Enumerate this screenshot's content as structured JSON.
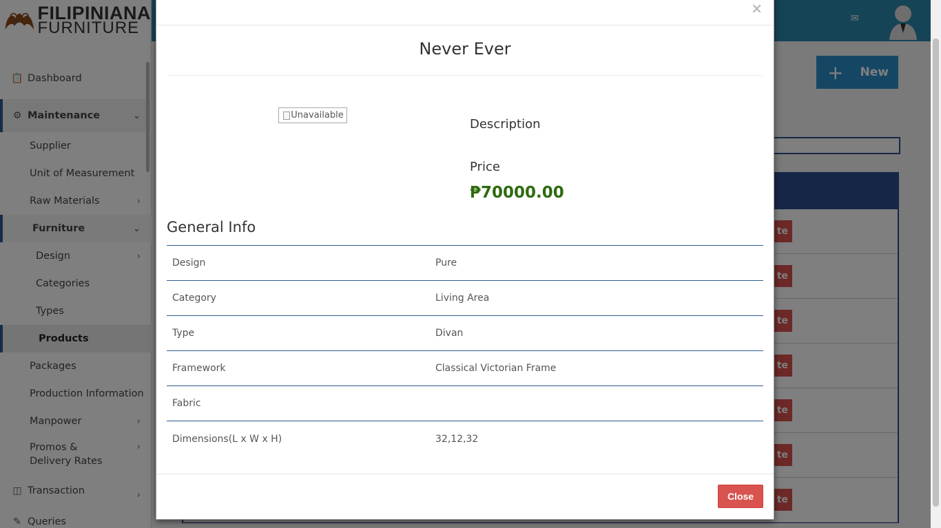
{
  "brand": {
    "line1": "FILIPINIANA",
    "line2": "FURNITURE"
  },
  "sidebar": {
    "items": [
      {
        "label": "Dashboard",
        "icon": "clipboard-icon"
      },
      {
        "label": "Maintenance",
        "icon": "gear-icon"
      },
      {
        "label": "Supplier"
      },
      {
        "label": "Unit of Measurement"
      },
      {
        "label": "Raw Materials"
      },
      {
        "label": "Furniture"
      },
      {
        "label": "Design"
      },
      {
        "label": "Categories"
      },
      {
        "label": "Types"
      },
      {
        "label": "Products"
      },
      {
        "label": "Packages"
      },
      {
        "label": "Production Information"
      },
      {
        "label": "Manpower"
      },
      {
        "label": "Promos & Delivery Rates"
      },
      {
        "label": "Transaction",
        "icon": "database-icon"
      },
      {
        "label": "Queries",
        "icon": "pencil-icon"
      }
    ]
  },
  "page": {
    "new_button_label": "New",
    "row_action_label": "te"
  },
  "modal": {
    "title": "Never Ever",
    "image_alt": "Unavailable",
    "description_label": "Description",
    "price_label": "Price",
    "price_value": "₱70000.00",
    "general_info_title": "General Info",
    "info": [
      {
        "key": "Design",
        "value": "Pure"
      },
      {
        "key": "Category",
        "value": "Living Area"
      },
      {
        "key": "Type",
        "value": "Divan"
      },
      {
        "key": "Framework",
        "value": "Classical Victorian Frame"
      },
      {
        "key": "Fabric",
        "value": ""
      },
      {
        "key": "Dimensions(L x W x H)",
        "value": "32,12,32"
      }
    ],
    "close_label": "Close",
    "close_x": "×"
  },
  "colors": {
    "topbar": "#2a88ad",
    "accent": "#2d4d8f",
    "danger": "#d9534f",
    "price": "#2d6b0e"
  }
}
